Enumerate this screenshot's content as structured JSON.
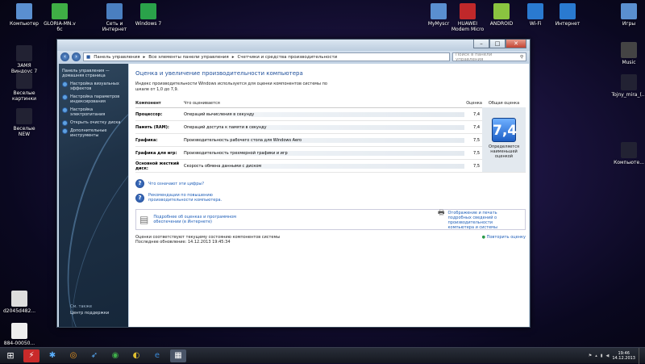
{
  "desktop": {
    "left_icons": [
      {
        "label": "Компьютер",
        "icon": "computer-icon",
        "color": "#5a8fd0"
      },
      {
        "label": "GLORIA-MN.v\nбс",
        "icon": "wrench-icon",
        "color": "#3fae45"
      },
      {
        "label": "Сеть и Интернет",
        "icon": "globe-icon",
        "color": "#4a7fc0"
      },
      {
        "label": "Windows 7",
        "icon": "shield-icon",
        "color": "#2aa24a"
      },
      {
        "label": "ЗАМЯ\nВиндоус 7\nсто",
        "icon": "document-icon",
        "color": "#223"
      },
      {
        "label": "Веселые\nкартинки",
        "icon": "document-icon",
        "color": "#223"
      },
      {
        "label": "Веселые\nNEW",
        "icon": "document-icon",
        "color": "#223"
      },
      {
        "label": "d2045d482...",
        "icon": "file-icon",
        "color": "#ddd"
      },
      {
        "label": "884-00050...",
        "icon": "file-icon",
        "color": "#eee"
      }
    ],
    "right_icons": [
      {
        "label": "MyMyscr",
        "icon": "monitor-icon",
        "color": "#5a8fd0"
      },
      {
        "label": "HUAWEI\nModem Micro",
        "icon": "modem-icon",
        "color": "#c0282a"
      },
      {
        "label": "ANDROID",
        "icon": "android-icon",
        "color": "#8ac440"
      },
      {
        "label": "Wi-Fi",
        "icon": "wifi-icon",
        "color": "#2a7ad0"
      },
      {
        "label": "Интернет",
        "icon": "ie-icon",
        "color": "#2a7ad0"
      },
      {
        "label": "Игры",
        "icon": "games-icon",
        "color": "#5a8fd0"
      },
      {
        "label": "Music",
        "icon": "music-icon",
        "color": "#444"
      },
      {
        "label": "Tojny_mira_(...",
        "icon": "document-icon",
        "color": "#223"
      },
      {
        "label": "Компьюте...",
        "icon": "document-icon",
        "color": "#223"
      }
    ]
  },
  "window": {
    "breadcrumb": [
      "Панель управления",
      "Все элементы панели управления",
      "Счетчики и средства производительности"
    ],
    "search_placeholder": "Поиск в панели управления",
    "controls": {
      "minimize": "–",
      "maximize": "□",
      "close": "✕"
    }
  },
  "sidebar": {
    "links": [
      "Панель управления — домашняя страница",
      "Настройка визуальных эффектов",
      "Настройка параметров индексирования",
      "Настройка электропитания",
      "Открыть очистку диска",
      "Дополнительные инструменты"
    ],
    "see_also": "См. также",
    "support": "Центр поддержки"
  },
  "main": {
    "title": "Оценка и увеличение производительности компьютера",
    "intro": "Индекс производительности Windows используется для оценки компонентов системы по шкале от 1,0 до 7,9.",
    "headers": {
      "component": "Компонент",
      "what": "Что оценивается",
      "score": "Оценка",
      "overall": "Общая оценка"
    },
    "rows": [
      {
        "component": "Процессор:",
        "what": "Операций вычисления в секунду",
        "score": "7,4"
      },
      {
        "component": "Память (RAM):",
        "what": "Операций доступа к памяти в секунду",
        "score": "7,4"
      },
      {
        "component": "Графика:",
        "what": "Производительность рабочего стола для Windows Aero",
        "score": "7,5"
      },
      {
        "component": "Графика для игр:",
        "what": "Производительность трехмерной графики и игр",
        "score": "7,5"
      },
      {
        "component": "Основной жесткий диск:",
        "what": "Скорость обмена данными с диском",
        "score": "7,5"
      }
    ],
    "overall_score": "7,4",
    "overall_caption": "Определяется наименьшей оценкой",
    "help_links": [
      "Что означают эти цифры?",
      "Рекомендации по повышению производительности компьютера."
    ],
    "right_link": "Отображение и печать подробных сведений о производительности компьютера и системы",
    "info_link": "Подробнее об оценках и программном обеспечении (в Интернете)",
    "status_line1": "Оценки соответствуют текущему состоянию компонентов системы",
    "status_line2": "Последнее обновление: 14.12.2013 19:45:34",
    "refresh": "Повторить оценку"
  },
  "taskbar": {
    "time": "19:46",
    "date": "14.12.2013"
  }
}
